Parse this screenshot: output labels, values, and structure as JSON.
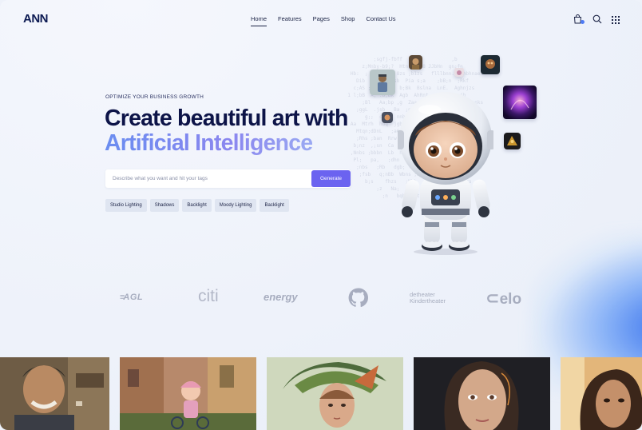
{
  "brand": {
    "logo": "ANN"
  },
  "nav": {
    "items": [
      {
        "label": "Home",
        "active": true
      },
      {
        "label": "Features",
        "active": false
      },
      {
        "label": "Pages",
        "active": false
      },
      {
        "label": "Shop",
        "active": false
      },
      {
        "label": "Contact Us",
        "active": false
      }
    ]
  },
  "header_icons": [
    "shopping-bag-icon",
    "search-icon",
    "grid-menu-icon"
  ],
  "hero": {
    "eyebrow": "OPTIMIZE YOUR BUSINESS GROWTH",
    "title_line1": "Create beautiful art with",
    "title_line2": "Artificial Intelligence",
    "search_placeholder": "Describe what you want and hit your tags",
    "generate_label": "Generate",
    "tags": [
      "Studio Lighting",
      "Shadows",
      "Backlight",
      "Moody Lighting",
      "Backlight"
    ]
  },
  "partners": [
    "AGL",
    "citi",
    "energy",
    "github",
    "detheater Kindertheater",
    "elo"
  ],
  "colors": {
    "accent": "#6b63f0",
    "navy": "#0d1448",
    "gradient_start": "#6a8df0",
    "gradient_end": "#9aa9f2"
  }
}
